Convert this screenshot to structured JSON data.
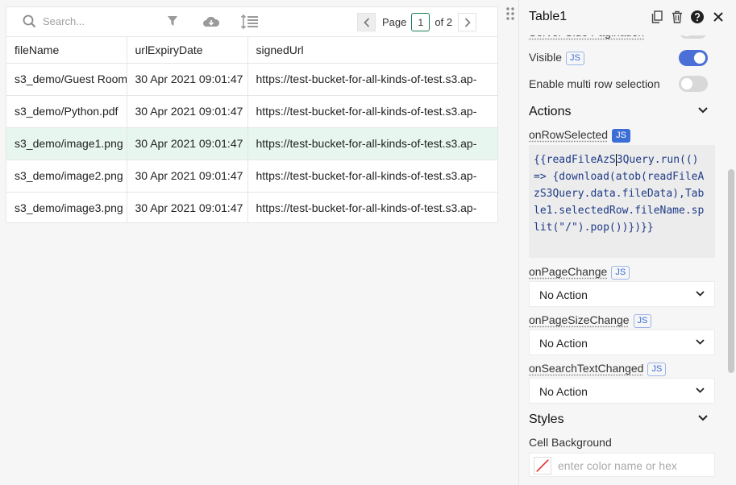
{
  "table": {
    "search_placeholder": "Search...",
    "pagination": {
      "page_label": "Page",
      "current_page": "1",
      "of_label": "of 2"
    },
    "columns": [
      "fileName",
      "urlExpiryDate",
      "signedUrl"
    ],
    "rows": [
      [
        "s3_demo/Guest Room",
        "30 Apr 2021 09:01:47",
        "https://test-bucket-for-all-kinds-of-test.s3.ap-"
      ],
      [
        "s3_demo/Python.pdf",
        "30 Apr 2021 09:01:47",
        "https://test-bucket-for-all-kinds-of-test.s3.ap-"
      ],
      [
        "s3_demo/image1.png",
        "30 Apr 2021 09:01:47",
        "https://test-bucket-for-all-kinds-of-test.s3.ap-"
      ],
      [
        "s3_demo/image2.png",
        "30 Apr 2021 09:01:47",
        "https://test-bucket-for-all-kinds-of-test.s3.ap-"
      ],
      [
        "s3_demo/image3.png",
        "30 Apr 2021 09:01:47",
        "https://test-bucket-for-all-kinds-of-test.s3.ap-"
      ]
    ],
    "selected_row_index": 2
  },
  "pane": {
    "title": "Table1",
    "partial_label": "Server Side Pagination",
    "visible_label": "Visible",
    "js_label": "JS",
    "multi_row_label": "Enable multi row selection",
    "actions_title": "Actions",
    "on_row_selected_label": "onRowSelected",
    "on_row_selected_code_before_cursor": "{{readFileAzS",
    "on_row_selected_code_after_cursor": "3Query.run(() => {download(atob(readFileAzS3Query.data.fileData),Table1.selectedRow.fileName.split(\"/\").pop())})}}",
    "on_page_change_label": "onPageChange",
    "on_page_change_value": "No Action",
    "on_page_size_change_label": "onPageSizeChange",
    "on_page_size_change_value": "No Action",
    "on_search_text_changed_label": "onSearchTextChanged",
    "on_search_text_changed_value": "No Action",
    "styles_title": "Styles",
    "cell_background_label": "Cell Background",
    "cell_background_placeholder": "enter color name or hex",
    "toggles": {
      "server_side_pagination": false,
      "visible": true,
      "multi_row_selection": false
    }
  },
  "colors": {
    "accent_blue": "#4a6fd6",
    "selected_row": "#e7f6ef",
    "pager_border": "#1a7f52"
  },
  "icons": [
    "search-icon",
    "filter-icon",
    "cloud-download-icon",
    "row-height-icon",
    "chevron-left-icon",
    "chevron-right-icon",
    "drag-handle-icon",
    "copy-icon",
    "trash-icon",
    "help-icon",
    "close-icon",
    "chevron-down-icon"
  ]
}
